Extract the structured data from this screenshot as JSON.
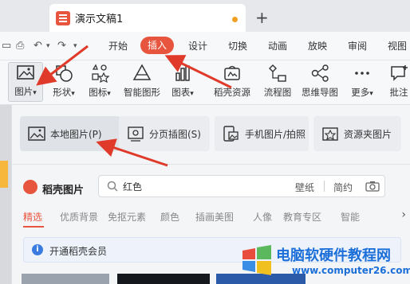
{
  "tab": {
    "title": "演示文稿1",
    "new_tab": "+"
  },
  "menu": {
    "items": [
      "开始",
      "插入",
      "设计",
      "切换",
      "动画",
      "放映",
      "审阅",
      "视图"
    ],
    "active": "插入"
  },
  "ribbon": {
    "items": [
      "图片",
      "形状",
      "图标",
      "智能图形",
      "图表",
      "稻壳资源",
      "流程图",
      "思维导图",
      "更多",
      "批注"
    ],
    "dropdown_marker": "▾"
  },
  "picture_panel": {
    "options": [
      "本地图片(P)",
      "分页插图(S)",
      "手机图片/拍照",
      "资源夹图片"
    ],
    "brand": "稻壳图片",
    "search": {
      "value": "红色",
      "chips": [
        "壁纸",
        "简约"
      ]
    },
    "categories": [
      "精选",
      "优质背景",
      "免抠元素",
      "颜色",
      "插画美图",
      "人像",
      "教育专区",
      "智能"
    ],
    "active_category": "精选",
    "banner": "开通稻壳会员"
  },
  "watermark": {
    "line1": "电脑软硬件教程网",
    "line2": "www.computer26.com"
  },
  "colors": {
    "accent": "#e8553e",
    "arrow": "#e03a2a",
    "link": "#1c6fd8"
  }
}
